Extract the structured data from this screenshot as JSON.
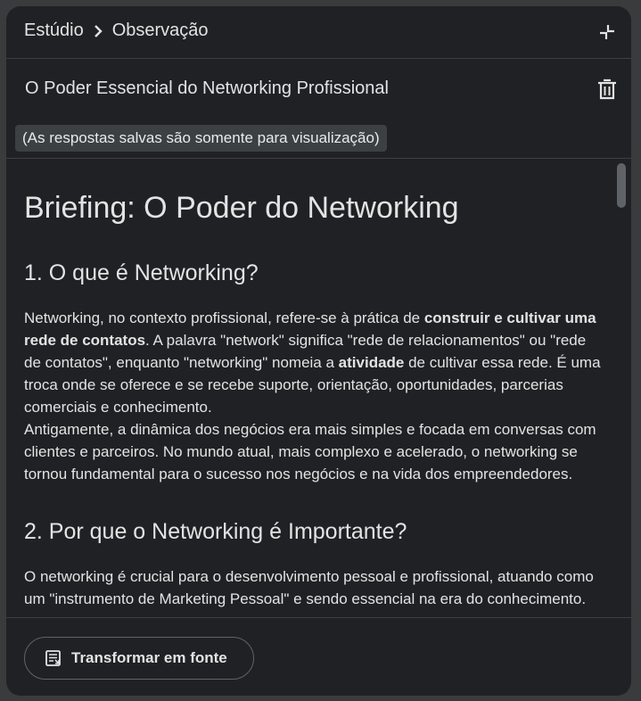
{
  "header": {
    "breadcrumb_root": "Estúdio",
    "breadcrumb_current": "Observação",
    "chevron_icon": "chevron-right-icon",
    "collapse_icon": "collapse-icon"
  },
  "note": {
    "title": "O Poder Essencial do Networking Profissional",
    "delete_icon": "trash-icon",
    "readonly_notice": "(As respostas salvas são somente para visualização)"
  },
  "content": {
    "h1": "Briefing: O Poder do Networking",
    "section1_title": "1. O que é Networking?",
    "section1_p1_a": "Networking, no contexto profissional, refere-se à prática de ",
    "section1_p1_b": "construir e cultivar uma rede de contatos",
    "section1_p1_c": ". A palavra \"network\" significa \"rede de relacionamentos\" ou \"rede de contatos\", enquanto \"networking\" nomeia a ",
    "section1_p1_d": "atividade",
    "section1_p1_e": " de cultivar essa rede. É uma troca onde se oferece e se recebe suporte, orientação, oportunidades, parcerias comerciais e conhecimento.",
    "section1_p2": "Antigamente, a dinâmica dos negócios era mais simples e focada em conversas com clientes e parceiros. No mundo atual, mais complexo e acelerado, o networking se tornou fundamental para o sucesso nos negócios e na vida dos empreendedores.",
    "section2_title": "2. Por que o Networking é Importante?",
    "section2_p1": "O networking é crucial para o desenvolvimento pessoal e profissional, atuando como um \"instrumento de Marketing Pessoal\" e sendo essencial na era do conhecimento."
  },
  "footer": {
    "button_label": "Transformar em fonte",
    "button_icon": "convert-source-icon"
  }
}
